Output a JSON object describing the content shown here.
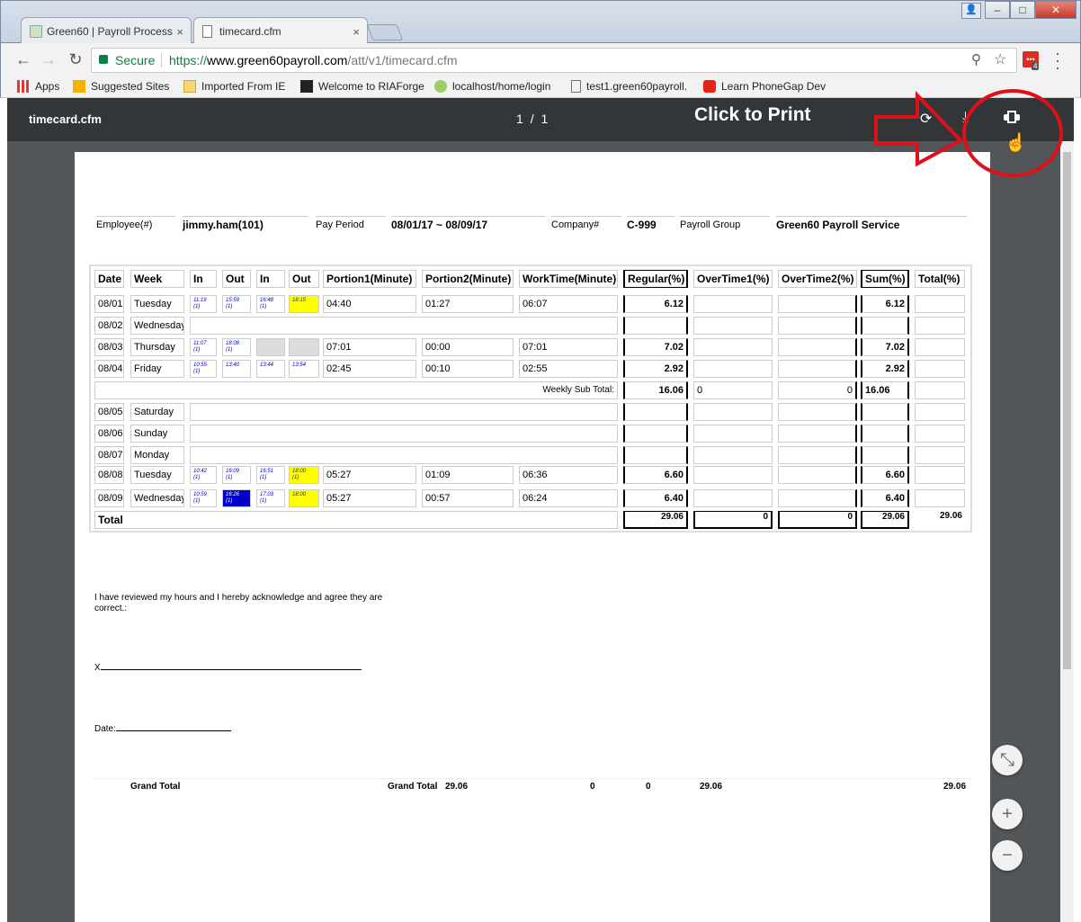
{
  "browser": {
    "tabs": [
      {
        "label": "Green60 | Payroll Process",
        "close": "×"
      },
      {
        "label": "timecard.cfm",
        "close": "×"
      }
    ],
    "window_controls": {
      "minimize": "–",
      "maximize": "□",
      "close": "✕"
    },
    "secure_label": "Secure",
    "url_prefix": "https://",
    "url_host": "www.green60payroll.com",
    "url_path": "/att/v1/timecard.cfm",
    "extension_badge": "4",
    "bookmarks": [
      "Apps",
      "Suggested Sites",
      "Imported From IE",
      "Welcome to RIAForge",
      "localhost/home/login",
      "test1.green60payroll.",
      "Learn PhoneGap Dev"
    ]
  },
  "viewer": {
    "filename": "timecard.cfm",
    "page_current": "1",
    "page_sep": "/",
    "page_total": "1",
    "annotation": "Click to Print"
  },
  "header": {
    "employee_label": "Employee(#)",
    "employee_value": "jimmy.ham(101)",
    "period_label": "Pay Period",
    "period_value": "08/01/17 ~ 08/09/17",
    "company_label": "Company#",
    "company_value": "C-999",
    "group_label": "Payroll Group",
    "group_value": "Green60 Payroll Service"
  },
  "table": {
    "columns": [
      "Date",
      "Week",
      "In",
      "Out",
      "In",
      "Out",
      "Portion1(Minute)",
      "Portion2(Minute)",
      "WorkTime(Minute)",
      "Regular(%)",
      "OverTime1(%)",
      "OverTime2(%)",
      "Sum(%)",
      "Total(%)"
    ],
    "rows": [
      {
        "date": "08/01",
        "week": "Tuesday",
        "in1": "11:19",
        "in1n": "(1)",
        "out1": "15:59",
        "out1n": "(1)",
        "in2": "16:48",
        "in2n": "(1)",
        "out2": "18:15",
        "out2n": "",
        "p1": "04:40",
        "p2": "01:27",
        "work": "06:07",
        "regular": "6.12",
        "ot1": "",
        "ot2": "",
        "sum": "6.12",
        "total": ""
      },
      {
        "date": "08/02",
        "week": "Wednesday"
      },
      {
        "date": "08/03",
        "week": "Thursday",
        "in1": "11:07",
        "in1n": "(1)",
        "out1": "18:08",
        "out1n": "(1)",
        "p1": "07:01",
        "p2": "00:00",
        "work": "07:01",
        "regular": "7.02",
        "sum": "7.02"
      },
      {
        "date": "08/04",
        "week": "Friday",
        "in1": "10:55",
        "in1n": "(1)",
        "out1": "13:40",
        "out1n": "",
        "in2": "13:44",
        "in2n": "",
        "out2": "13:54",
        "out2n": "",
        "p1": "02:45",
        "p2": "00:10",
        "work": "02:55",
        "regular": "2.92",
        "sum": "2.92"
      },
      {
        "date": "08/05",
        "week": "Saturday"
      },
      {
        "date": "08/06",
        "week": "Sunday"
      },
      {
        "date": "08/07",
        "week": "Monday"
      },
      {
        "date": "08/08",
        "week": "Tuesday",
        "in1": "10:42",
        "in1n": "(1)",
        "out1": "16:09",
        "out1n": "(1)",
        "in2": "16:51",
        "in2n": "(1)",
        "out2": "18:00",
        "out2n": "(1)",
        "p1": "05:27",
        "p2": "01:09",
        "work": "06:36",
        "regular": "6.60",
        "sum": "6.60"
      },
      {
        "date": "08/09",
        "week": "Wednesday",
        "in1": "10:59",
        "in1n": "(1)",
        "out1": "16:26",
        "out1n": "(1)",
        "in2": "17:03",
        "in2n": "(1)",
        "out2": "18:00",
        "out2n": "",
        "p1": "05:27",
        "p2": "00:57",
        "work": "06:24",
        "regular": "6.40",
        "sum": "6.40"
      }
    ],
    "weekly_subtotal": {
      "label": "Weekly Sub Total:",
      "regular": "16.06",
      "ot1": "0",
      "ot2": "0",
      "sum": "16.06"
    },
    "total": {
      "label": "Total",
      "regular": "29.06",
      "ot1": "0",
      "ot2": "0",
      "sum": "29.06",
      "total": "29.06"
    }
  },
  "acknowledgement": {
    "text": "I have reviewed my hours and I hereby acknowledge and agree they are correct.:",
    "sign_prefix": "X",
    "date_label": "Date:"
  },
  "grand_total": {
    "label1": "Grand Total",
    "label2": "Grand Total",
    "regular": "29.06",
    "ot1": "0",
    "ot2": "0",
    "sum": "29.06",
    "total": "29.06"
  },
  "colors": {
    "annotation_red": "#e0101a",
    "viewer_bar": "#323639",
    "viewer_bg": "#525659",
    "late_punch": "#ffff00",
    "edited_punch": "#0000cc"
  }
}
